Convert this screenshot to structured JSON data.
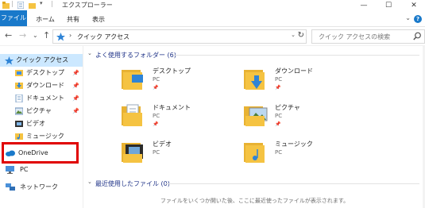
{
  "window": {
    "title": "エクスプローラー",
    "controls": {
      "minimize": "—",
      "maximize": "☐",
      "close": "✕"
    }
  },
  "ribbon": {
    "tabs": [
      "ファイル",
      "ホーム",
      "共有",
      "表示"
    ],
    "expand": "⌄",
    "help": "?"
  },
  "nav": {
    "back": "←",
    "forward": "→",
    "recent": "⌄",
    "up": "↑",
    "address_chevron": "›",
    "address": "クイック アクセス",
    "address_dropdown": "⌄",
    "refresh": "↻",
    "search_placeholder": "クイック アクセスの検索"
  },
  "sidebar": {
    "items": [
      {
        "label": "クイック アクセス",
        "icon": "star-icon",
        "pinned": false,
        "selected": true
      },
      {
        "label": "デスクトップ",
        "icon": "desktop-folder-icon",
        "pinned": true
      },
      {
        "label": "ダウンロード",
        "icon": "download-icon",
        "pinned": true
      },
      {
        "label": "ドキュメント",
        "icon": "document-icon",
        "pinned": true
      },
      {
        "label": "ピクチャ",
        "icon": "pictures-icon",
        "pinned": true
      },
      {
        "label": "ビデオ",
        "icon": "video-icon",
        "pinned": false
      },
      {
        "label": "ミュージック",
        "icon": "music-icon",
        "pinned": false
      },
      {
        "label": "OneDrive",
        "icon": "cloud-icon",
        "pinned": false
      },
      {
        "label": "PC",
        "icon": "pc-icon",
        "pinned": false
      },
      {
        "label": "ネットワーク",
        "icon": "network-icon",
        "pinned": false
      }
    ],
    "pin_glyph": "📌"
  },
  "main": {
    "frequent_header": "よく使用するフォルダー (6)",
    "recent_header": "最近使用したファイル (0)",
    "empty_message": "ファイルをいくつか開いた後、ここに最近使ったファイルが表示されます。",
    "folders": [
      {
        "name": "デスクトップ",
        "location": "PC",
        "pinned": true,
        "icon": "desktop-folder-icon"
      },
      {
        "name": "ダウンロード",
        "location": "PC",
        "pinned": true,
        "icon": "download-folder-icon"
      },
      {
        "name": "ドキュメント",
        "location": "PC",
        "pinned": true,
        "icon": "documents-folder-icon"
      },
      {
        "name": "ピクチャ",
        "location": "PC",
        "pinned": true,
        "icon": "pictures-folder-icon"
      },
      {
        "name": "ビデオ",
        "location": "PC",
        "pinned": false,
        "icon": "video-folder-icon"
      },
      {
        "name": "ミュージック",
        "location": "PC",
        "pinned": false,
        "icon": "music-folder-icon"
      }
    ],
    "pin_glyph": "📌",
    "collapse_glyph": "⌄"
  },
  "colors": {
    "accent": "#1979ca",
    "folder": "#f5c342",
    "highlight_border": "#e00000",
    "selected_bg": "#cce8ff",
    "header_text": "#1e3287"
  }
}
